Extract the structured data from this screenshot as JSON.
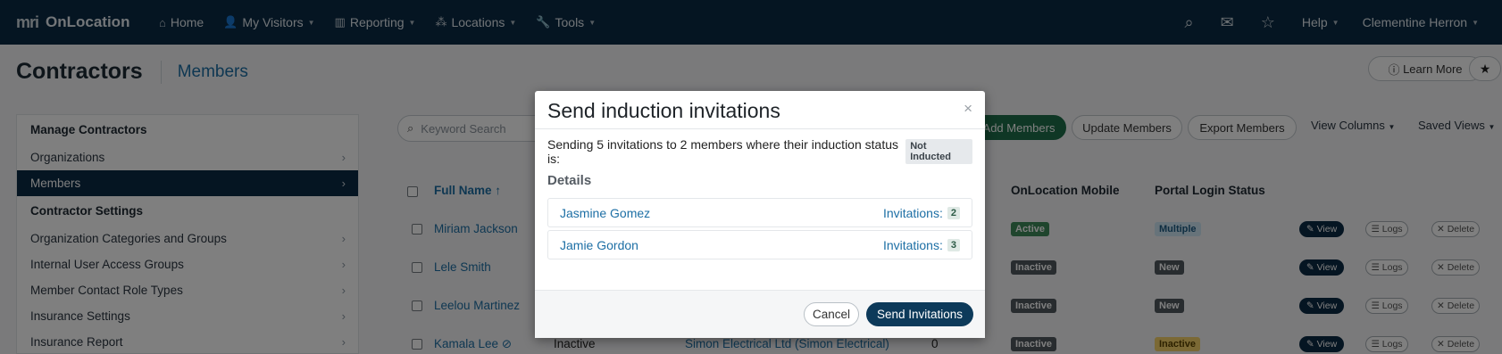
{
  "nav": {
    "logo_mark": "mri",
    "logo_text": "OnLocation",
    "items": [
      {
        "icon": "home-icon",
        "glyph": "⌂",
        "label": "Home",
        "caret": false
      },
      {
        "icon": "user-icon",
        "glyph": "👤",
        "label": "My Visitors",
        "caret": true
      },
      {
        "icon": "chart-icon",
        "glyph": "▥",
        "label": "Reporting",
        "caret": true
      },
      {
        "icon": "locations-icon",
        "glyph": "⁂",
        "label": "Locations",
        "caret": true
      },
      {
        "icon": "wrench-icon",
        "glyph": "🔧",
        "label": "Tools",
        "caret": true
      }
    ],
    "help": "Help",
    "user": "Clementine Herron"
  },
  "header": {
    "title": "Contractors",
    "subtitle": "Members",
    "learn_more": "Learn More"
  },
  "sidebar": {
    "section1": "Manage Contractors",
    "items1": [
      "Organizations",
      "Members"
    ],
    "section2": "Contractor Settings",
    "items2": [
      "Organization Categories and Groups",
      "Internal User Access Groups",
      "Member Contact Role Types",
      "Insurance Settings",
      "Insurance Report"
    ]
  },
  "toolbar": {
    "search_placeholder": "Keyword Search",
    "add_members": "Add Members",
    "update_members": "Update Members",
    "export_members": "Export Members",
    "view_columns": "View Columns",
    "saved_views": "Saved Views"
  },
  "table": {
    "col_full_name": "Full Name",
    "sort_indicator": "↑",
    "col_mobile": "OnLocation Mobile",
    "col_portal": "Portal Login Status",
    "rows": [
      {
        "name": "Miriam Jackson",
        "status": "",
        "org": "",
        "count": "",
        "mobile": "Active",
        "portal": "Multiple"
      },
      {
        "name": "Lele Smith",
        "status": "",
        "org": "",
        "count": "",
        "mobile": "Inactive",
        "portal": "New"
      },
      {
        "name": "Leelou Martinez",
        "status": "",
        "org": "",
        "count": "",
        "mobile": "Inactive",
        "portal": "New"
      },
      {
        "name": "Kamala Lee",
        "status": "Inactive",
        "org": "Simon Electrical Ltd (Simon Electrical)",
        "count": "0",
        "mobile": "Inactive",
        "portal": "Inactive"
      }
    ],
    "actions": {
      "view": "View",
      "logs": "Logs",
      "delete": "Delete"
    }
  },
  "modal": {
    "title": "Send induction invitations",
    "intro": "Sending 5 invitations to 2 members where their induction status is:",
    "status_tag": "Not Inducted",
    "details_label": "Details",
    "invitations_label": "Invitations:",
    "members": [
      {
        "name": "Jasmine Gomez",
        "count": "2"
      },
      {
        "name": "Jamie Gordon",
        "count": "3"
      }
    ],
    "cancel": "Cancel",
    "send": "Send Invitations"
  }
}
